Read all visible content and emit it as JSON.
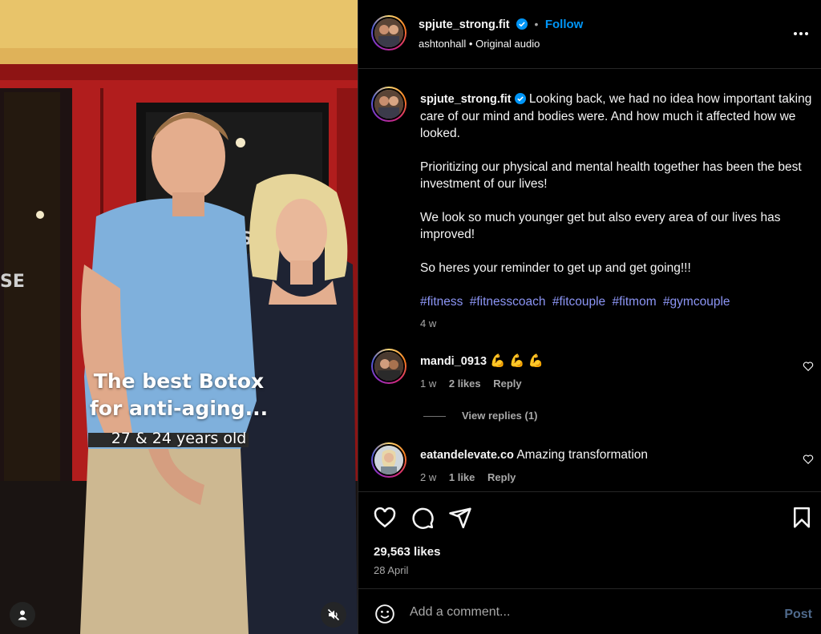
{
  "media": {
    "overlay_title_line1": "The best Botox",
    "overlay_title_line2": "for anti-aging...",
    "overlay_subtitle": "27 & 24 years old",
    "restaurant_sign_fragment1": "H'S",
    "restaurant_sign_fragment2": "SE",
    "user_button_icon": "user-icon",
    "mute_button_icon": "muted-speaker-icon"
  },
  "header": {
    "username": "spjute_strong.fit",
    "separator": "•",
    "follow_label": "Follow",
    "audio_user": "ashtonhall",
    "audio_label": "Original audio",
    "more_icon": "more-options-icon"
  },
  "caption": {
    "username": "spjute_strong.fit",
    "para1": "Looking back, we had no idea how important taking care of our mind and bodies were. And how much it affected how we looked.",
    "para2": "Prioritizing our physical and mental health together has been the best investment of our lives!",
    "para3": "We look so much younger get but also every area of our lives has improved!",
    "para4": "So heres your reminder to get up and get going!!!",
    "hashtags": [
      "#fitness",
      "#fitnesscoach",
      "#fitcouple",
      "#fitmom",
      "#gymcouple"
    ],
    "age": "4 w"
  },
  "comments": [
    {
      "username": "mandi_0913",
      "text": "💪 💪 💪",
      "age": "1 w",
      "likes": "2 likes",
      "reply_label": "Reply",
      "view_replies": "View replies (1)"
    },
    {
      "username": "eatandelevate.co",
      "text": "Amazing transformation",
      "age": "2 w",
      "likes": "1 like",
      "reply_label": "Reply"
    }
  ],
  "actions": {
    "like_count": "29,563 likes",
    "date": "28 April",
    "icons": [
      "heart-icon",
      "comment-icon",
      "share-icon",
      "bookmark-icon"
    ]
  },
  "comment_box": {
    "placeholder": "Add a comment...",
    "post_label": "Post",
    "emoji_icon": "emoji-icon"
  },
  "colors": {
    "accent_blue": "#0095f6",
    "hashtag": "#8c95f5",
    "muted_text": "#a8a8a8",
    "divider": "#262626",
    "post_disabled": "#4f6a8c"
  }
}
